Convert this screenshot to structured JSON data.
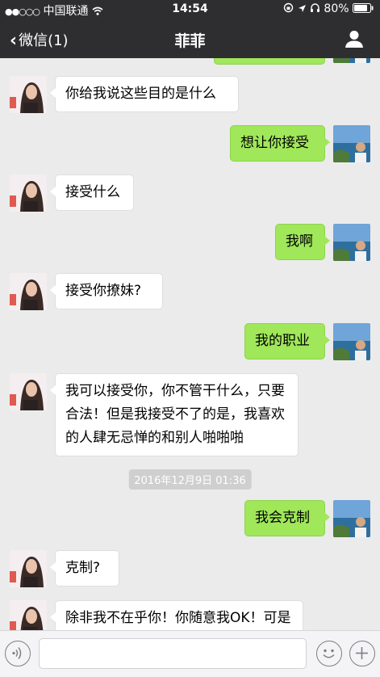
{
  "status_bar": {
    "signal": "●●○○○",
    "carrier": "中国联通",
    "wifi_icon": "wifi-icon",
    "time": "14:54",
    "battery": "80%"
  },
  "nav": {
    "back_label": "微信(1)",
    "title": "菲菲",
    "profile_icon": "person-icon"
  },
  "messages": [
    {
      "from": "her",
      "text": "你给我说这些目的是什么"
    },
    {
      "from": "me",
      "text": "想让你接受"
    },
    {
      "from": "her",
      "text": "接受什么"
    },
    {
      "from": "me",
      "text": "我啊"
    },
    {
      "from": "her",
      "text": "接受你撩妹?"
    },
    {
      "from": "me",
      "text": "我的职业"
    },
    {
      "from": "her",
      "text": "我可以接受你，你不管干什么，只要合法！但是我接受不了的是，我喜欢的人肆无忌惮的和别人啪啪啪"
    },
    {
      "timestamp": "2016年12月9日 01:36"
    },
    {
      "from": "me",
      "text": "我会克制"
    },
    {
      "from": "her",
      "text": "克制?"
    },
    {
      "from": "her",
      "text": "除非我不在乎你！你随意我OK！可是我不是那种人"
    }
  ],
  "input_bar": {
    "voice_icon": "voice-icon",
    "emoji_icon": "emoji-icon",
    "plus_icon": "plus-icon",
    "text_value": ""
  },
  "colors": {
    "bar_bg": "#2e2e31",
    "chat_bg": "#ebebeb",
    "bubble_me": "#a0e75a",
    "bubble_her": "#ffffff"
  }
}
